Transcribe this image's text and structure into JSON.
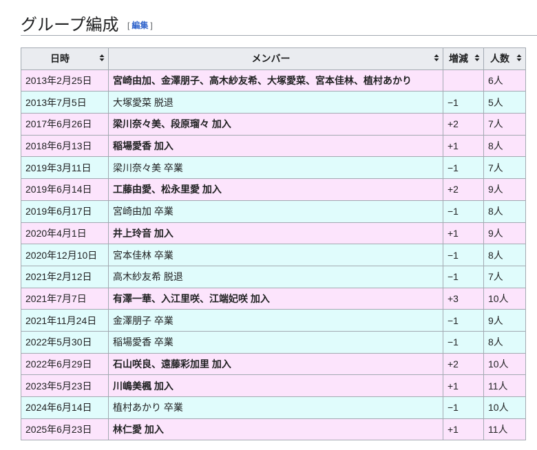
{
  "section": {
    "title": "グループ編成",
    "edit_label": "編集",
    "bracket_open": "[",
    "bracket_close": "]"
  },
  "colors": {
    "join_row": "#fce4fc",
    "leave_row": "#e0fcfc",
    "header": "#eaecf0",
    "link": "#3366cc"
  },
  "table": {
    "headers": [
      "日時",
      "メンバー",
      "増減",
      "人数"
    ],
    "sort_icon": "sort-arrows-icon",
    "rows": [
      {
        "date": "2013年2月25日",
        "members": "宮崎由加、金澤朋子、高木紗友希、大塚愛菜、宮本佳林、植村あかり",
        "change": "",
        "count": "6人",
        "type": "join"
      },
      {
        "date": "2013年7月5日",
        "members": "大塚愛菜 脱退",
        "change": "−1",
        "count": "5人",
        "type": "leave"
      },
      {
        "date": "2017年6月26日",
        "members": "梁川奈々美、段原瑠々 加入",
        "change": "+2",
        "count": "7人",
        "type": "join"
      },
      {
        "date": "2018年6月13日",
        "members": "稲場愛香 加入",
        "change": "+1",
        "count": "8人",
        "type": "join"
      },
      {
        "date": "2019年3月11日",
        "members": "梁川奈々美 卒業",
        "change": "−1",
        "count": "7人",
        "type": "leave"
      },
      {
        "date": "2019年6月14日",
        "members": "工藤由愛、松永里愛 加入",
        "change": "+2",
        "count": "9人",
        "type": "join"
      },
      {
        "date": "2019年6月17日",
        "members": "宮崎由加 卒業",
        "change": "−1",
        "count": "8人",
        "type": "leave"
      },
      {
        "date": "2020年4月1日",
        "members": "井上玲音 加入",
        "change": "+1",
        "count": "9人",
        "type": "join"
      },
      {
        "date": "2020年12月10日",
        "members": "宮本佳林 卒業",
        "change": "−1",
        "count": "8人",
        "type": "leave"
      },
      {
        "date": "2021年2月12日",
        "members": "高木紗友希 脱退",
        "change": "−1",
        "count": "7人",
        "type": "leave"
      },
      {
        "date": "2021年7月7日",
        "members": "有澤一華、入江里咲、江端妃咲 加入",
        "change": "+3",
        "count": "10人",
        "type": "join"
      },
      {
        "date": "2021年11月24日",
        "members": "金澤朋子 卒業",
        "change": "−1",
        "count": "9人",
        "type": "leave"
      },
      {
        "date": "2022年5月30日",
        "members": "稲場愛香 卒業",
        "change": "−1",
        "count": "8人",
        "type": "leave"
      },
      {
        "date": "2022年6月29日",
        "members": "石山咲良、遠藤彩加里 加入",
        "change": "+2",
        "count": "10人",
        "type": "join"
      },
      {
        "date": "2023年5月23日",
        "members": "川嶋美楓 加入",
        "change": "+1",
        "count": "11人",
        "type": "join"
      },
      {
        "date": "2024年6月14日",
        "members": "植村あかり 卒業",
        "change": "−1",
        "count": "10人",
        "type": "leave"
      },
      {
        "date": "2025年6月23日",
        "members": "林仁愛 加入",
        "change": "+1",
        "count": "11人",
        "type": "join"
      }
    ]
  }
}
